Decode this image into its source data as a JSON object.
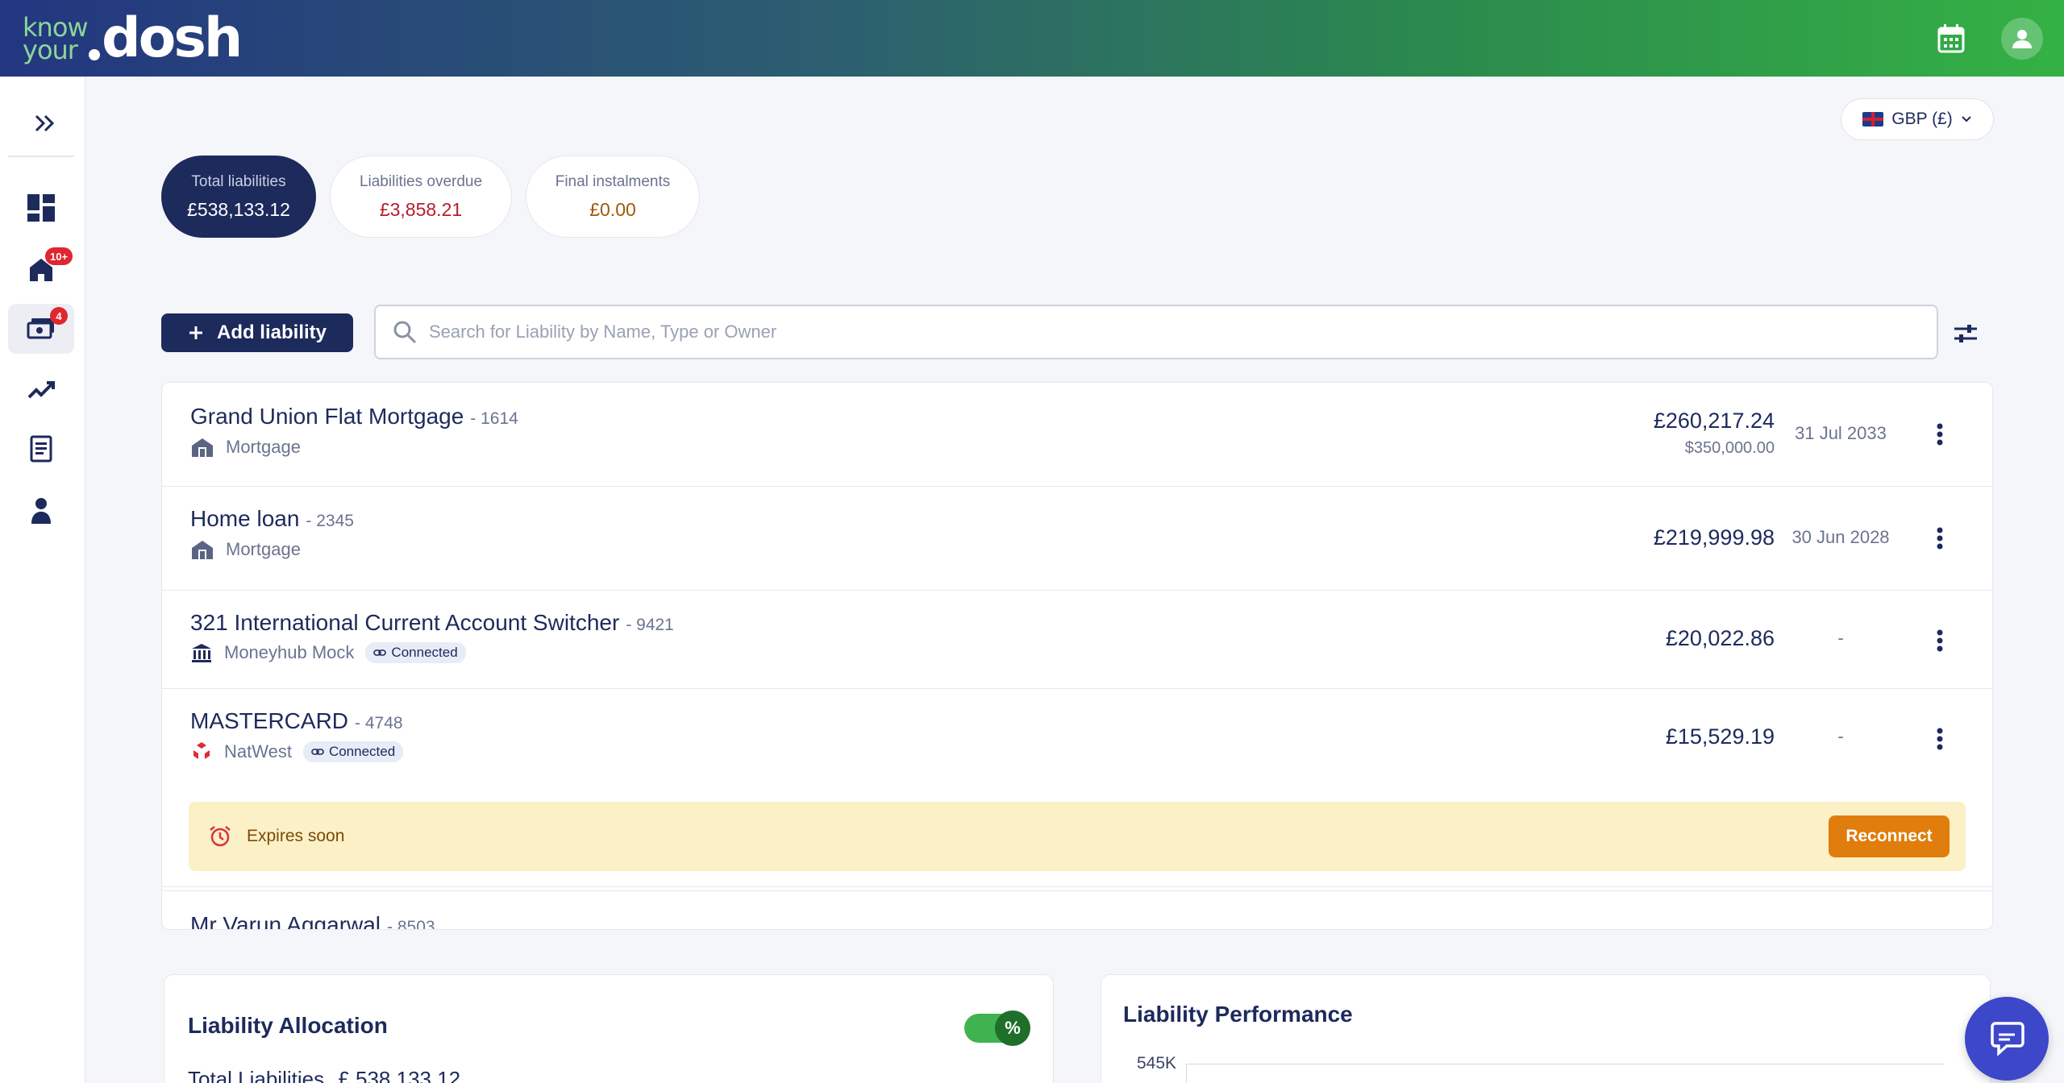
{
  "brand": {
    "logo_small": "know your",
    "logo_big": "dosh"
  },
  "header": {
    "calendar_icon": "calendar-icon",
    "profile_icon": "user-icon"
  },
  "sidebar": {
    "items": [
      {
        "name": "dashboard",
        "icon": "dashboard-icon"
      },
      {
        "name": "property",
        "icon": "home-icon",
        "badge": "10+"
      },
      {
        "name": "liabilities",
        "icon": "money-icon",
        "badge": "4",
        "active": true
      },
      {
        "name": "performance",
        "icon": "trend-icon"
      },
      {
        "name": "reports",
        "icon": "document-icon"
      },
      {
        "name": "advisor",
        "icon": "person-icon"
      }
    ]
  },
  "currency": {
    "label": "GBP (£)"
  },
  "summary": [
    {
      "label": "Total liabilities",
      "value": "£538,133.12",
      "color": "#ffffff"
    },
    {
      "label": "Liabilities overdue",
      "value": "£3,858.21",
      "color": "#b3202a"
    },
    {
      "label": "Final instalments",
      "value": "£0.00",
      "color": "#a0590a"
    }
  ],
  "actions": {
    "add_label": "Add liability",
    "search_placeholder": "Search for Liability by Name, Type or Owner"
  },
  "liabilities": [
    {
      "name": "Grand Union Flat Mortgage",
      "number": "- 1614",
      "type": "Mortgage",
      "amount": "£260,217.24",
      "original": "$350,000.00",
      "date": "31 Jul 2033"
    },
    {
      "name": "Home loan",
      "number": "- 2345",
      "type": "Mortgage",
      "amount": "£219,999.98",
      "date": "30 Jun 2028"
    },
    {
      "name": "321 International Current Account Switcher",
      "number": "- 9421",
      "type": "Moneyhub Mock",
      "status": "Connected",
      "amount": "£20,022.86",
      "date": "-"
    },
    {
      "name": "MASTERCARD",
      "number": "- 4748",
      "type": "NatWest",
      "status": "Connected",
      "amount": "£15,529.19",
      "date": "-"
    },
    {
      "name": "Mr Varun Aggarwal",
      "number": "- 8503"
    }
  ],
  "expiry": {
    "text": "Expires soon",
    "button": "Reconnect"
  },
  "allocation": {
    "title": "Liability Allocation",
    "toggle_label": "%",
    "total_label": "Total Liabilities",
    "total_value": "£ 538,133.12"
  },
  "performance": {
    "title": "Liability Performance",
    "y_top": "545K"
  }
}
